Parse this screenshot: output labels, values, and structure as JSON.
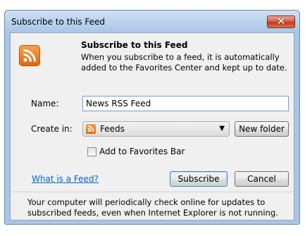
{
  "window": {
    "title": "Subscribe to this Feed",
    "close_glyph": "✕"
  },
  "header": {
    "heading": "Subscribe to this Feed",
    "description": "When you subscribe to a feed, it is automatically added to the Favorites Center and kept up to date."
  },
  "form": {
    "name_label": "Name:",
    "name_value": "News RSS Feed",
    "create_in_label": "Create in:",
    "create_in_selected": "Feeds",
    "new_folder_label": "New folder",
    "add_to_favorites_bar_label": "Add to Favorites Bar",
    "add_to_favorites_bar_checked": false
  },
  "actions": {
    "help_link": "What is a Feed?",
    "subscribe_label": "Subscribe",
    "cancel_label": "Cancel"
  },
  "footer": {
    "text": "Your computer will periodically check online for updates to subscribed feeds, even when Internet Explorer is not running."
  },
  "colors": {
    "rss_orange": "#e3640d",
    "link_blue": "#0066cc",
    "close_red": "#c23a22"
  },
  "icons": {
    "feed": "rss-icon",
    "close": "close-icon",
    "dropdown": "chevron-down-icon"
  }
}
